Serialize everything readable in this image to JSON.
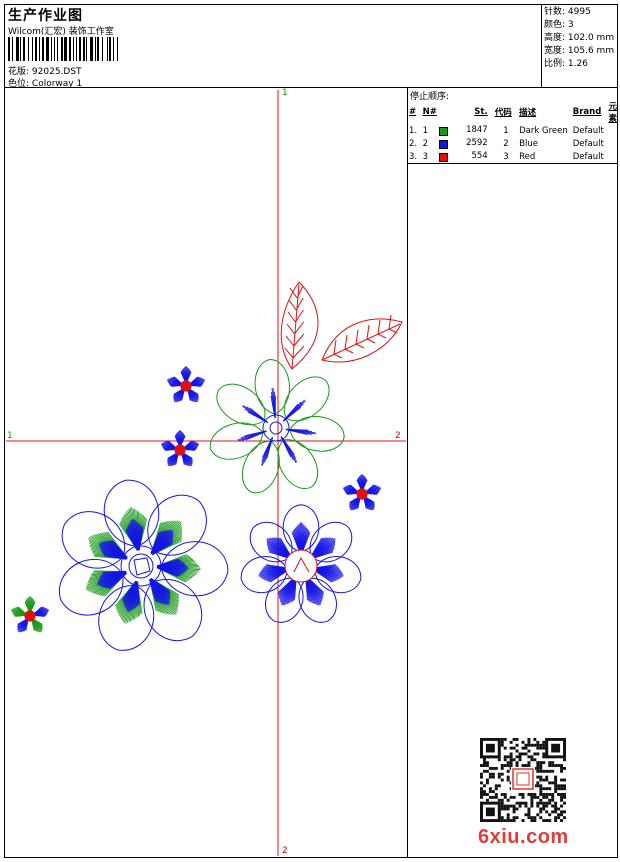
{
  "header": {
    "title": "生产作业图",
    "company": "Wilcom(汇宏) 装饰工作室",
    "design_label": "花版:",
    "design_value": "92025.DST",
    "colorway_label": "色位:",
    "colorway_value": "Colorway 1"
  },
  "stats": [
    {
      "label": "针数:",
      "value": "4995"
    },
    {
      "label": "颜色:",
      "value": "3"
    },
    {
      "label": "高度:",
      "value": "102.0 mm"
    },
    {
      "label": "宽度:",
      "value": "105.6 mm"
    },
    {
      "label": "比例:",
      "value": "1.26"
    }
  ],
  "stop_sequence": {
    "title": "停止顺序:",
    "headers": [
      "#",
      "N#",
      "St.",
      "代码",
      "描述",
      "Brand",
      "元素"
    ],
    "rows": [
      {
        "index": "1.",
        "n": "1",
        "color": "#1a9a1a",
        "stitches": "1847",
        "code": "1",
        "description": "Dark Green",
        "brand": "Default"
      },
      {
        "index": "2.",
        "n": "2",
        "color": "#1515e6",
        "stitches": "2592",
        "code": "2",
        "description": "Blue",
        "brand": "Default"
      },
      {
        "index": "3.",
        "n": "3",
        "color": "#e01010",
        "stitches": "554",
        "code": "3",
        "description": "Red",
        "brand": "Default"
      }
    ]
  },
  "axes": {
    "top": "1",
    "bottom": "2",
    "left": "1",
    "right": "2"
  },
  "colors": {
    "green": "#1a9a1a",
    "blue": "#1515e6",
    "red": "#e01010",
    "axis": "#e01010"
  },
  "watermark": "6xiu.com"
}
